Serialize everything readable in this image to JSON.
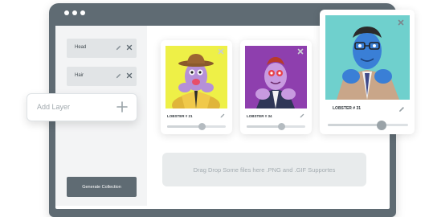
{
  "layers": [
    {
      "label": "Head"
    },
    {
      "label": "Hair"
    }
  ],
  "add_layer": {
    "placeholder": "Add Layer"
  },
  "generate_button": {
    "label": "Generate Collection"
  },
  "cards": [
    {
      "name": "LOBSTER # 21",
      "background": "#eef047",
      "slider_value": 0.6
    },
    {
      "name": "LOBSTER # 34",
      "background": "#8e3fae",
      "slider_value": 0.6
    },
    {
      "name": "LOBSTER # 31",
      "background": "#6fd0cd",
      "slider_value": 0.67
    }
  ],
  "dropzone": {
    "text": "Drag Drop Some files here .PNG and .GIF Supportes"
  },
  "colors": {
    "frame": "#5f6b73",
    "sidebar": "#f3f4f5",
    "layer_row": "#e1e4e6"
  },
  "icons": [
    "pencil-icon",
    "close-icon",
    "plus-icon",
    "window-dot-icon"
  ]
}
